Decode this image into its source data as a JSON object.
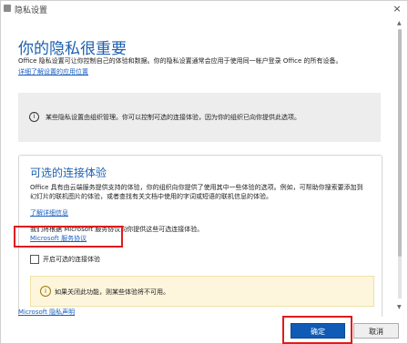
{
  "window": {
    "title": "隐私设置",
    "close_glyph": "×"
  },
  "header": {
    "title": "你的隐私很重要",
    "description": "Office 隐私设置可让你控制自己的体验和数据。你的隐私设置通常会应用于使用同一帐户登录 Office 的所有设备。",
    "learn_more_link": "详细了解设置的应用位置"
  },
  "info_banner": {
    "icon": "info-icon",
    "text": "某些隐私设置由组织管理。你可以控制可选的连接体验，因为你的组织已向你提供此选项。"
  },
  "optional_experiences": {
    "title": "可选的连接体验",
    "description_lines": [
      "Office 具有由云端服务提供支持的体验，你的组织向你提供了使用其中一些体验的选项。例如，可帮助你搜索要添加到",
      "幻灯片的联机图片的体验，或者查找有关文档中使用的字词或短语的联机信息的体验。"
    ],
    "learn_more_link": "了解详细信息",
    "agreement_text": "我们将根据 Microsoft 服务协议向你提供这些可选连接体验。",
    "service_agreement_link": "Microsoft 服务协议",
    "checkbox_label": "开启可选的连接体验",
    "checkbox_checked": false,
    "warning_icon": "info-icon",
    "warning_text": "如果关闭此功能，则某些体验将不可用。"
  },
  "footer": {
    "privacy_link": "Microsoft 隐私声明"
  },
  "buttons": {
    "ok_label": "确定",
    "cancel_label": "取消"
  },
  "colors": {
    "title_blue": "#1c5fb0",
    "link_blue": "#1b5fc1",
    "primary_button": "#0f5bb5",
    "highlight_red": "#e01b1b",
    "warning_bg": "#fdf6dc"
  }
}
